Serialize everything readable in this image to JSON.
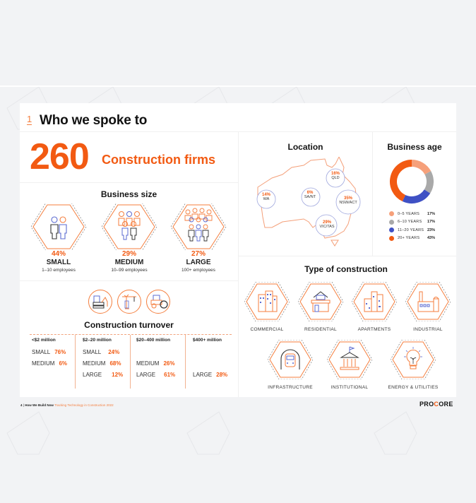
{
  "section": {
    "number": "1",
    "title": "Who we spoke to"
  },
  "headline": {
    "count": "260",
    "label": "Construction firms"
  },
  "business_size": {
    "title": "Business size",
    "items": [
      {
        "pct": "44%",
        "name": "SMALL",
        "sub": "1–10 employees",
        "icon": "two-workers-icon"
      },
      {
        "pct": "29%",
        "name": "MEDIUM",
        "sub": "10–99 employees",
        "icon": "group-workers-icon"
      },
      {
        "pct": "27%",
        "name": "LARGE",
        "sub": "100+ employees",
        "icon": "crowd-workers-icon"
      }
    ]
  },
  "turnover": {
    "title": "Construction turnover",
    "icons": [
      "excavator-icon",
      "crane-icon",
      "road-roller-icon"
    ],
    "columns": [
      {
        "head": "<$2 million",
        "rows": [
          {
            "label": "SMALL",
            "value": "76%"
          },
          {
            "label": "MEDIUM",
            "value": "6%"
          }
        ]
      },
      {
        "head": "$2–20 million",
        "rows": [
          {
            "label": "SMALL",
            "value": "24%"
          },
          {
            "label": "MEDIUM",
            "value": "68%"
          },
          {
            "label": "LARGE",
            "value": "12%"
          }
        ]
      },
      {
        "head": "$20–400 million",
        "rows": [
          {
            "label": "MEDIUM",
            "value": "26%"
          },
          {
            "label": "LARGE",
            "value": "61%"
          }
        ]
      },
      {
        "head": "$400+ million",
        "rows": [
          {
            "label": "LARGE",
            "value": "28%"
          }
        ]
      }
    ]
  },
  "location": {
    "title": "Location",
    "regions": [
      {
        "pct": "16%",
        "name": "QLD"
      },
      {
        "pct": "14%",
        "name": "WA"
      },
      {
        "pct": "6%",
        "name": "SA/NT"
      },
      {
        "pct": "35%",
        "name": "NSW/ACT"
      },
      {
        "pct": "29%",
        "name": "VIC/TAS"
      }
    ]
  },
  "business_age": {
    "title": "Business age",
    "segments": [
      {
        "label": "0–5 YEARS",
        "value": "17%",
        "fraction": 0.17,
        "color": "#f6a07a"
      },
      {
        "label": "6–10 YEARS",
        "value": "17%",
        "fraction": 0.17,
        "color": "#a9a9a9"
      },
      {
        "label": "11–20 YEARS",
        "value": "23%",
        "fraction": 0.23,
        "color": "#3f51c4"
      },
      {
        "label": "20+ YEARS",
        "value": "43%",
        "fraction": 0.43,
        "color": "#f25a12"
      }
    ]
  },
  "construction_type": {
    "title": "Type of construction",
    "items": [
      {
        "label": "COMMERCIAL",
        "icon": "office-building-icon"
      },
      {
        "label": "RESIDENTIAL",
        "icon": "house-icon"
      },
      {
        "label": "APARTMENTS",
        "icon": "apartments-icon"
      },
      {
        "label": "INDUSTRIAL",
        "icon": "factory-icon"
      },
      {
        "label": "INFRASTRUCTURE",
        "icon": "train-tunnel-icon"
      },
      {
        "label": "INSTITUTIONAL",
        "icon": "institution-building-icon"
      },
      {
        "label": "ENERGY & UTILITIES",
        "icon": "lightbulb-icon"
      }
    ]
  },
  "footer": {
    "page": "4",
    "separator": "|",
    "publication": "How We Build Now",
    "subtitle": "Tracking Technology in Construction 2022",
    "brand_left": "PRO",
    "brand_mid": "C",
    "brand_right": "ORE"
  },
  "colors": {
    "accent": "#f25a12",
    "accent_light": "#f6a07a",
    "blue": "#3f51c4",
    "gray": "#a9a9a9",
    "background": "#f2f3f5"
  }
}
